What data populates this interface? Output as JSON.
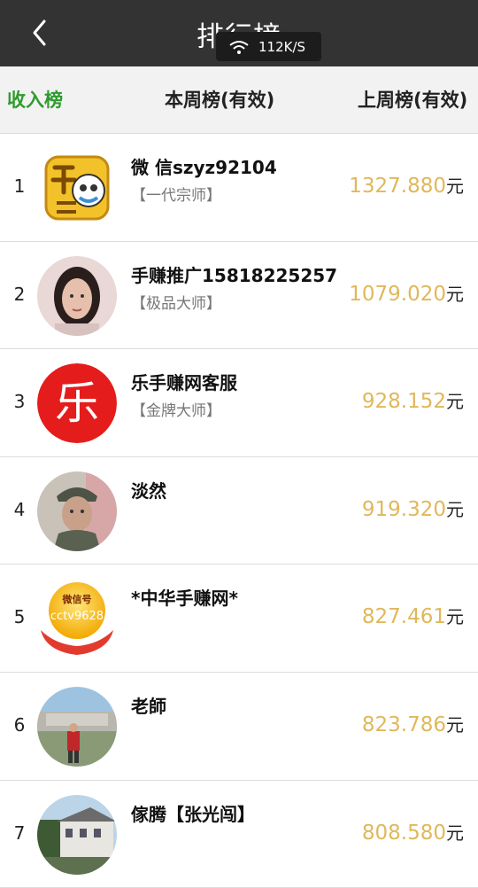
{
  "header": {
    "title": "排行榜",
    "network_speed": "112K/S"
  },
  "tabs": [
    {
      "label": "收入榜",
      "active": true
    },
    {
      "label": "本周榜(有效)",
      "active": false
    },
    {
      "label": "上周榜(有效)",
      "active": false
    }
  ],
  "colors": {
    "topbar": "#333333",
    "active_tab": "#2e9b2e",
    "amount": "#e0b85a"
  },
  "rankings": [
    {
      "rank": "1",
      "name": "微 信szyz92104",
      "level": "【一代宗师】",
      "amount": "1327.880",
      "unit": "元",
      "avatar": "coin-money-avatar"
    },
    {
      "rank": "2",
      "name": "手赚推广15818225257",
      "level": "【极品大师】",
      "amount": "1079.020",
      "unit": "元",
      "avatar": "woman-portrait-avatar"
    },
    {
      "rank": "3",
      "name": "乐手赚网客服",
      "level": "【金牌大师】",
      "amount": "928.152",
      "unit": "元",
      "avatar": "le-logo-avatar",
      "avatar_text": "乐"
    },
    {
      "rank": "4",
      "name": "淡然",
      "level": "",
      "amount": "919.320",
      "unit": "元",
      "avatar": "man-portrait-avatar"
    },
    {
      "rank": "5",
      "name": "*中华手赚网*",
      "level": "",
      "amount": "827.461",
      "unit": "元",
      "avatar": "wechat-logo-avatar",
      "avatar_text_1": "微信号",
      "avatar_text_2": "cctv9628"
    },
    {
      "rank": "6",
      "name": "老師",
      "level": "",
      "amount": "823.786",
      "unit": "元",
      "avatar": "person-outdoor-avatar"
    },
    {
      "rank": "7",
      "name": "傢腾【张光闯】",
      "level": "",
      "amount": "808.580",
      "unit": "元",
      "avatar": "building-avatar"
    }
  ]
}
